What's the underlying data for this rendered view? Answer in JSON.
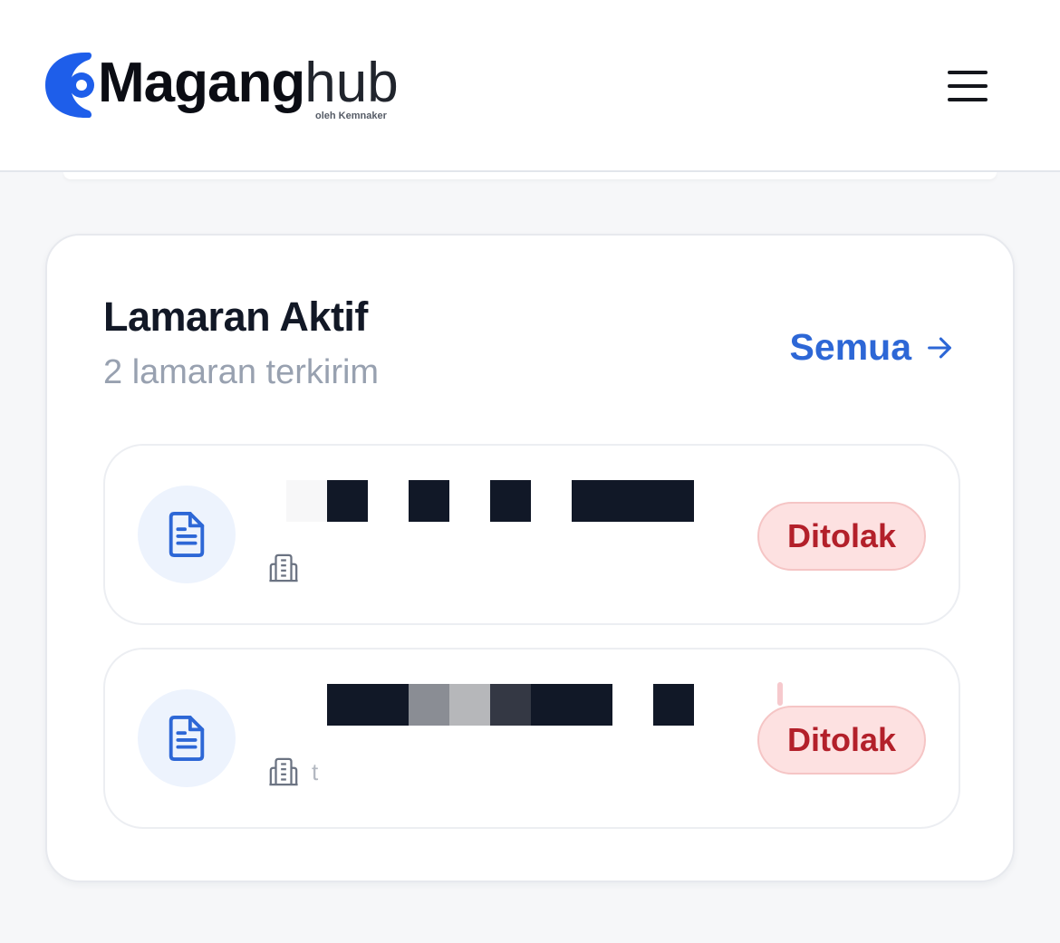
{
  "header": {
    "logo_main": "Maganghub",
    "logo_main_bold": "Magang",
    "logo_main_light": "hub",
    "logo_sub": "oleh Kemnaker",
    "menu_icon": "hamburger-menu-icon"
  },
  "card": {
    "title": "Lamaran Aktif",
    "subtitle": "2 lamaran terkirim",
    "see_all_label": "Semua",
    "see_all_icon": "arrow-right-icon"
  },
  "applications": [
    {
      "title_redacted": true,
      "company_name": "",
      "status": "Ditolak",
      "icon": "document-icon",
      "company_icon": "building-icon"
    },
    {
      "title_redacted": true,
      "company_name": "t",
      "status": "Ditolak",
      "icon": "document-icon",
      "company_icon": "building-icon"
    }
  ],
  "colors": {
    "brand_blue": "#1e5eea",
    "link_blue": "#2d67d6",
    "status_red_text": "#b3202a",
    "status_red_bg": "#fde1e1",
    "title_dark": "#121826",
    "muted_gray": "#98a1b0"
  }
}
